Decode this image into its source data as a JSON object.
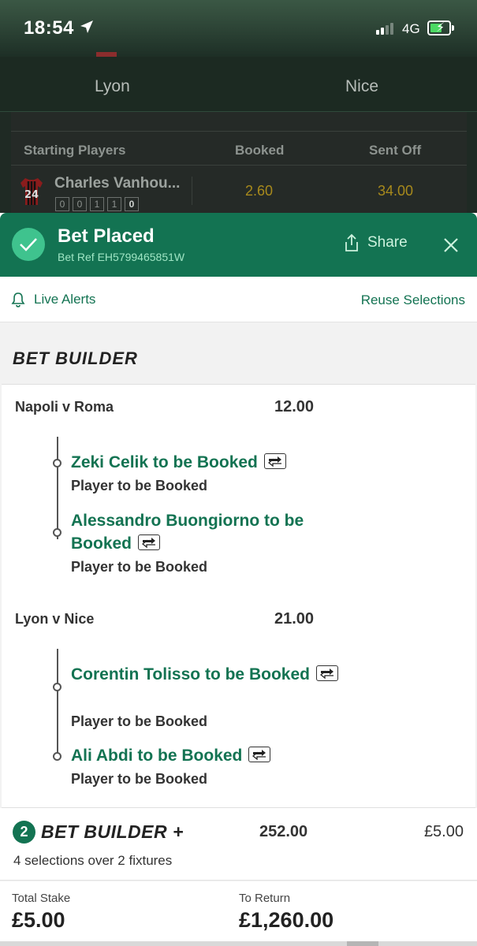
{
  "status_bar": {
    "time": "18:54",
    "network": "4G"
  },
  "match_header": {
    "home_team": "Lyon",
    "away_team": "Nice"
  },
  "players_table": {
    "headers": [
      "Starting Players",
      "Booked",
      "Sent Off"
    ],
    "row": {
      "shirt_number": "24",
      "name": "Charles Vanhou...",
      "stats": [
        "0",
        "0",
        "1",
        "1",
        "0"
      ],
      "booked_odds": "2.60",
      "sent_off_odds": "34.00"
    }
  },
  "banner": {
    "title": "Bet Placed",
    "bet_ref": "Bet Ref EH5799465851W",
    "share_label": "Share"
  },
  "alerts": {
    "live_alerts_label": "Live Alerts",
    "reuse_label": "Reuse Selections"
  },
  "bet_builder": {
    "title": "BET BUILDER",
    "fixtures": [
      {
        "name": "Napoli v Roma",
        "odds": "12.00",
        "selections": [
          {
            "title": "Zeki Celik to be Booked",
            "market": "Player to be Booked"
          },
          {
            "title": "Alessandro Buongiorno to be Booked",
            "market": "Player to be Booked"
          }
        ]
      },
      {
        "name": "Lyon v Nice",
        "odds": "21.00",
        "selections": [
          {
            "title": "Corentin Tolisso to be Booked",
            "market": "Player to be Booked"
          },
          {
            "title": "Ali Abdi to be Booked",
            "market": "Player to be Booked"
          }
        ]
      }
    ]
  },
  "summary": {
    "count": "2",
    "label": "BET BUILDER +",
    "odds": "252.00",
    "stake": "£5.00",
    "description": "4 selections over 2 fixtures"
  },
  "totals": {
    "stake_label": "Total Stake",
    "stake_value": "£5.00",
    "return_label": "To Return",
    "return_value": "£1,260.00"
  },
  "colors": {
    "brand_green": "#137352",
    "accent_green": "#3fc38e",
    "odds_gold": "#a88a1c"
  }
}
